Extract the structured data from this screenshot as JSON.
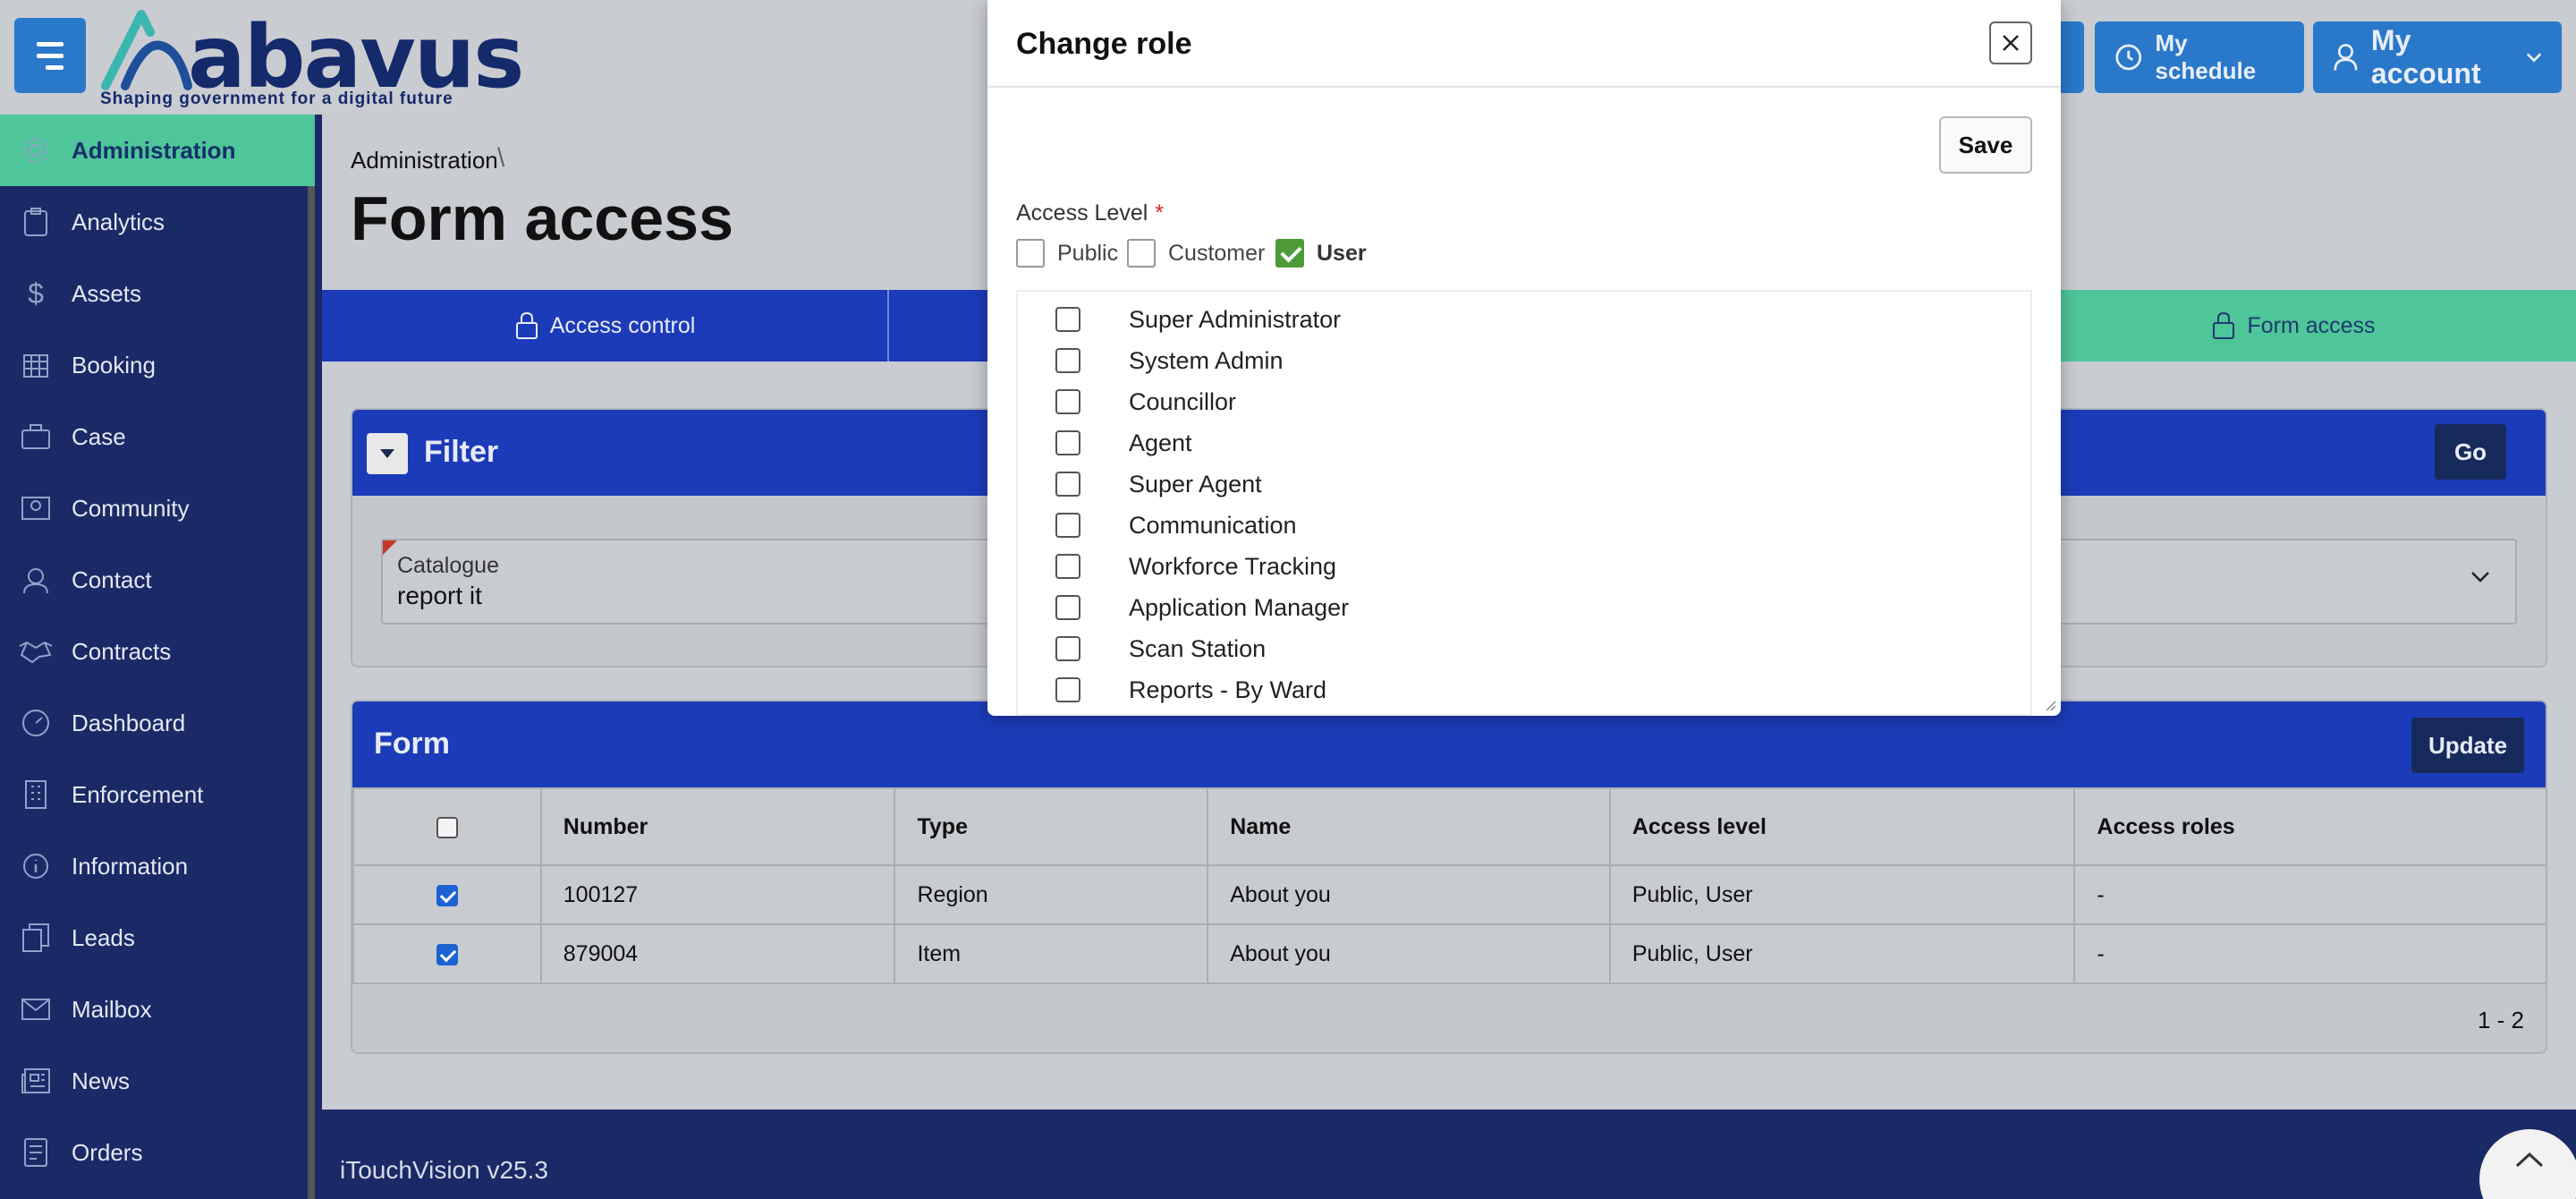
{
  "header": {
    "logo_text": "abavus",
    "logo_tagline": "Shaping government for a digital future",
    "my_schedule": "My schedule",
    "my_account": "My account"
  },
  "sidebar": {
    "items": [
      {
        "label": "Administration",
        "icon": "gear-icon"
      },
      {
        "label": "Analytics",
        "icon": "clipboard-icon"
      },
      {
        "label": "Assets",
        "icon": "dollar-icon"
      },
      {
        "label": "Booking",
        "icon": "calendar-icon"
      },
      {
        "label": "Case",
        "icon": "briefcase-icon"
      },
      {
        "label": "Community",
        "icon": "community-icon"
      },
      {
        "label": "Contact",
        "icon": "headset-icon"
      },
      {
        "label": "Contracts",
        "icon": "handshake-icon"
      },
      {
        "label": "Dashboard",
        "icon": "gauge-icon"
      },
      {
        "label": "Enforcement",
        "icon": "building-icon"
      },
      {
        "label": "Information",
        "icon": "info-icon"
      },
      {
        "label": "Leads",
        "icon": "copy-icon"
      },
      {
        "label": "Mailbox",
        "icon": "envelope-icon"
      },
      {
        "label": "News",
        "icon": "newspaper-icon"
      },
      {
        "label": "Orders",
        "icon": "orders-icon"
      }
    ]
  },
  "main": {
    "breadcrumb": "Administration",
    "breadcrumb_sep": "\\",
    "title": "Form access",
    "tabs": [
      {
        "label": "Access control"
      },
      {
        "label": "Form access"
      }
    ],
    "filter": {
      "title": "Filter",
      "go": "Go",
      "catalogue_label": "Catalogue",
      "catalogue_value": "report it"
    },
    "form": {
      "title": "Form",
      "update": "Update",
      "columns": [
        "Number",
        "Type",
        "Name",
        "Access level",
        "Access roles"
      ],
      "rows": [
        {
          "number": "100127",
          "type": "Region",
          "name": "About you",
          "access_level": "Public, User",
          "access_roles": "-",
          "checked": true
        },
        {
          "number": "879004",
          "type": "Item",
          "name": "About you",
          "access_level": "Public, User",
          "access_roles": "-",
          "checked": true
        }
      ],
      "pager": "1 - 2"
    }
  },
  "footer": {
    "version": "iTouchVision v25.3"
  },
  "modal": {
    "title": "Change role",
    "save": "Save",
    "access_level_label": "Access Level",
    "required_mark": "*",
    "access_options": [
      {
        "label": "Public",
        "checked": false
      },
      {
        "label": "Customer",
        "checked": false
      },
      {
        "label": "User",
        "checked": true
      }
    ],
    "roles": [
      "Super Administrator",
      "System Admin",
      "Councillor",
      "Agent",
      "Super Agent",
      "Communication",
      "Workforce Tracking",
      "Application Manager",
      "Scan Station",
      "Reports - By Ward"
    ]
  },
  "colors": {
    "nav_blue": "#1c3bb8",
    "sidebar": "#1a2a66",
    "active_green": "#4fc59a",
    "header_btn": "#2a78c9"
  }
}
